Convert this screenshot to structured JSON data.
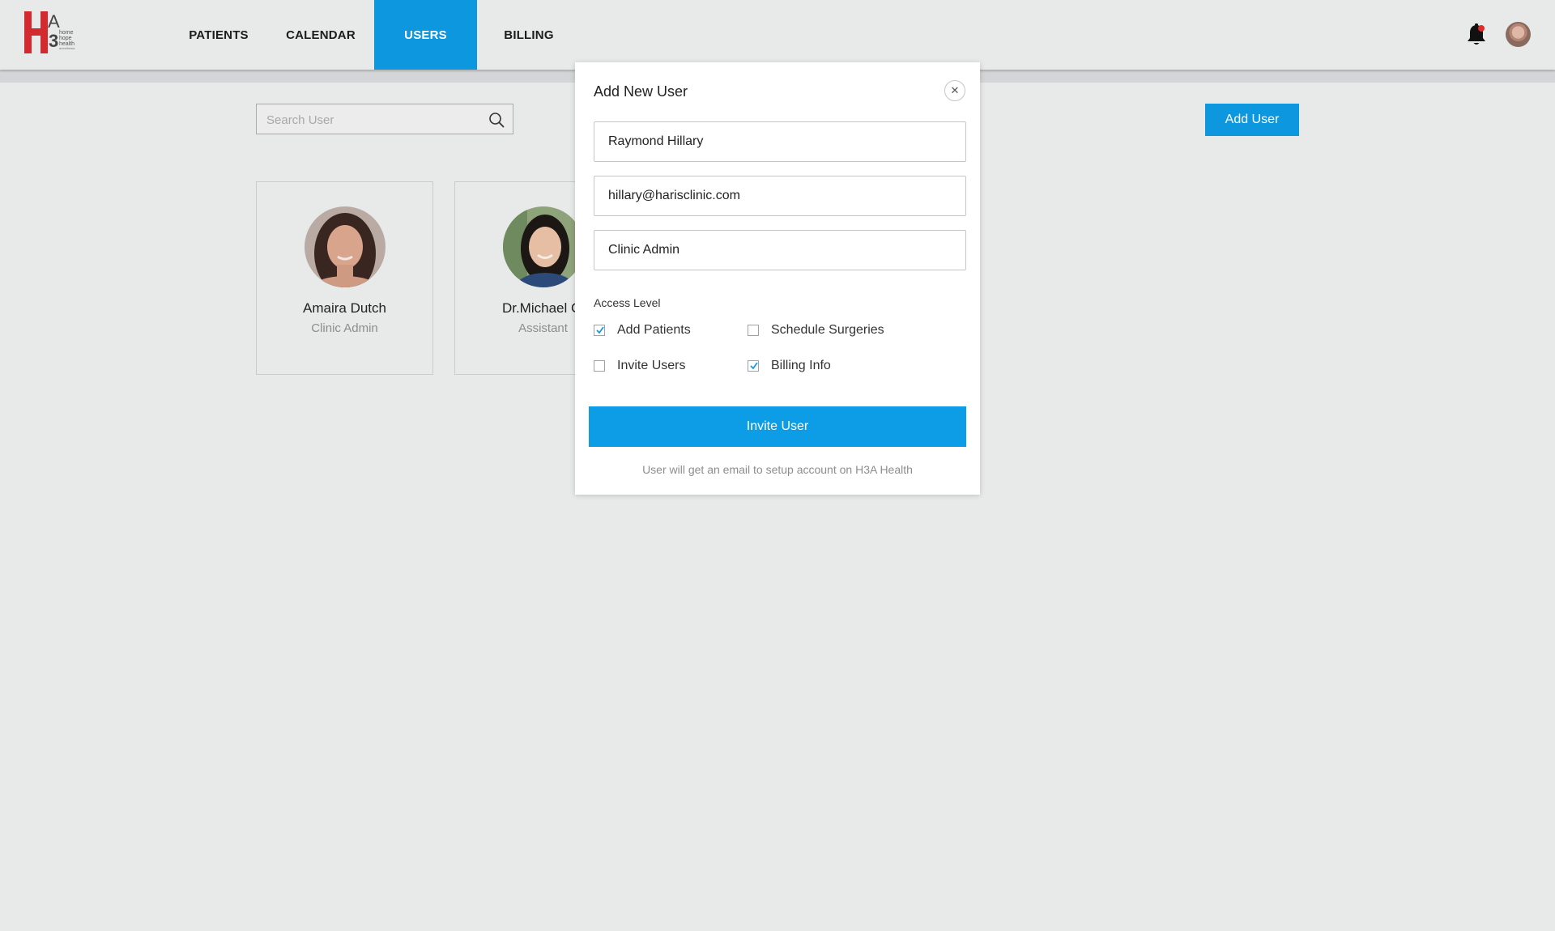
{
  "brand": {
    "logo_letters": "H3A",
    "logo_words": [
      "home",
      "hope",
      "health",
      "anesthesia"
    ]
  },
  "nav": {
    "items": [
      {
        "label": "PATIENTS",
        "active": false
      },
      {
        "label": "CALENDAR",
        "active": false
      },
      {
        "label": "USERS",
        "active": true
      },
      {
        "label": "BILLING",
        "active": false
      }
    ]
  },
  "header": {
    "notification_icon": "bell-icon",
    "has_unread_notification": true
  },
  "search": {
    "placeholder": "Search User",
    "value": ""
  },
  "toolbar": {
    "add_user_label": "Add User"
  },
  "users": [
    {
      "name": "Amaira Dutch",
      "role": "Clinic Admin"
    },
    {
      "name": "Dr.Michael Cl",
      "role": "Assistant"
    }
  ],
  "modal": {
    "title": "Add New User",
    "close_icon": "close-icon",
    "name_value": "Raymond Hillary",
    "email_value": "hillary@harisclinic.com",
    "role_value": "Clinic Admin",
    "access_level_label": "Access Level",
    "permissions": [
      {
        "label": "Add Patients",
        "checked": true
      },
      {
        "label": "Schedule Surgeries",
        "checked": false
      },
      {
        "label": "Invite Users",
        "checked": false
      },
      {
        "label": "Billing Info",
        "checked": true
      }
    ],
    "submit_label": "Invite User",
    "note": "User will get an email to setup account on H3A Health"
  },
  "colors": {
    "accent": "#0d97de",
    "background": "#e8e9e9",
    "logo_red": "#d32a2f"
  }
}
